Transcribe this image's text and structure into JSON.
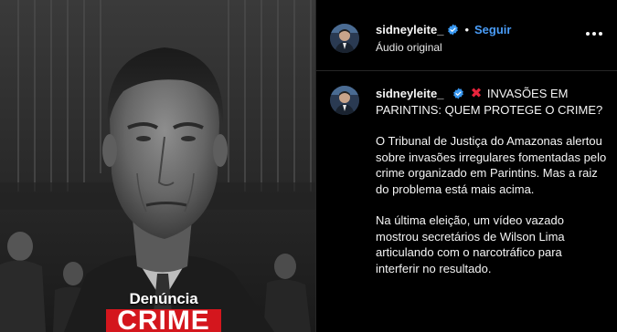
{
  "post": {
    "username": "sidneyleite_",
    "follow_label": "Seguir",
    "separator": "•",
    "audio_label": "Áudio original",
    "more_icon": "more-horizontal-icon",
    "verified_icon": "verified-badge-icon"
  },
  "media": {
    "tag_line1": "Denúncia",
    "tag_line2": "CRIME",
    "tag_color": "#d4161d"
  },
  "caption": {
    "username": "sidneyleite_",
    "x_emoji": "✖",
    "headline": "INVASÕES EM PARINTINS: QUEM PROTEGE O CRIME?",
    "paragraph1": "O Tribunal de Justiça do Amazonas alertou sobre invasões irregulares fomentadas pelo crime organizado em Parintins. Mas a raiz do problema está mais acima.",
    "paragraph2": "Na última eleição, um vídeo vazado mostrou secretários de Wilson Lima articulando com o narcotráfico para interferir no resultado."
  },
  "colors": {
    "accent_blue": "#4a9df8",
    "x_red": "#e8243c",
    "verified_blue": "#3897f0",
    "background": "#000000"
  }
}
